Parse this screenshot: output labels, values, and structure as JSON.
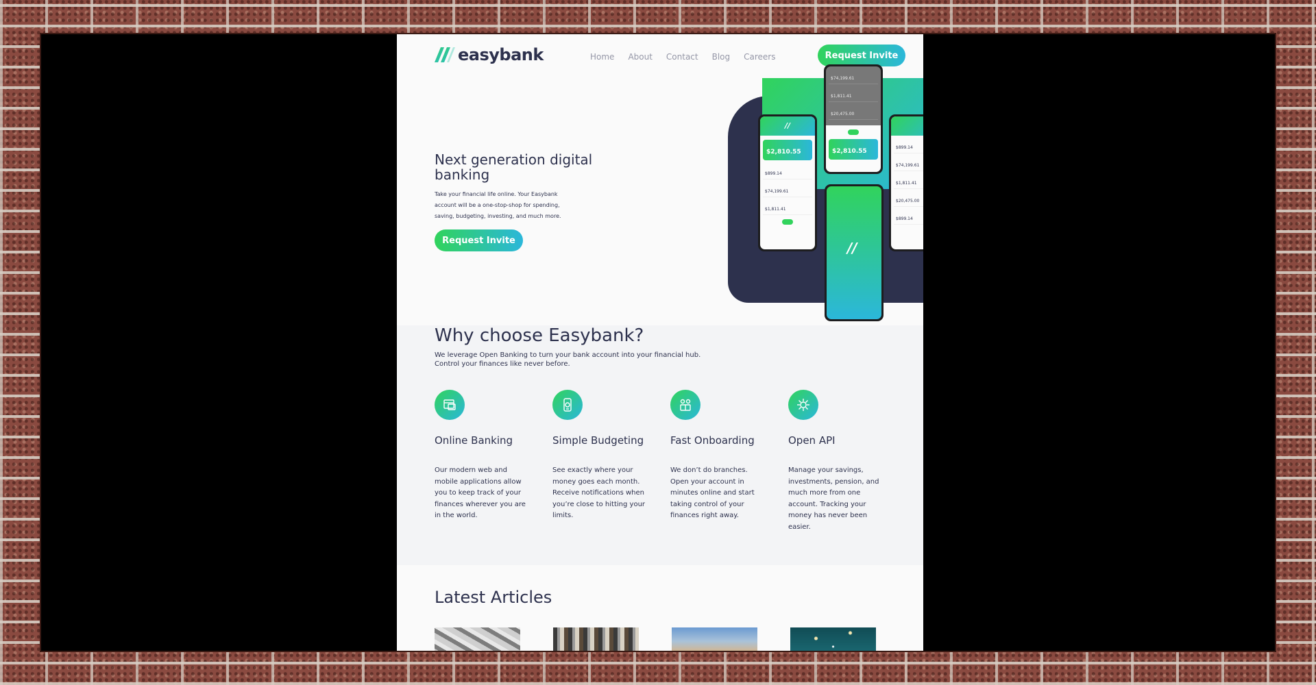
{
  "nav": {
    "logo_text": "easybank",
    "links": [
      "Home",
      "About",
      "Contact",
      "Blog",
      "Careers"
    ],
    "cta_label": "Request Invite"
  },
  "hero": {
    "title": "Next generation digital banking",
    "text": "Take your financial life online. Your Easybank account will be a one-stop-shop for spending, saving, budgeting, investing, and much more.",
    "cta_label": "Request Invite",
    "phone_screens": {
      "left": {
        "card": "$2,810.55",
        "rows": [
          "$899.14",
          "$74,199.61",
          "$1,811.41"
        ]
      },
      "top": {
        "rows": [
          "$74,199.61",
          "$1,811.41",
          "$20,475.00"
        ],
        "card": "$2,810.55"
      },
      "right": {
        "rows": [
          "$899.14",
          "$74,199.61",
          "$1,811.41",
          "$20,475.00",
          "$899.14"
        ]
      }
    }
  },
  "why": {
    "title": "Why choose Easybank?",
    "subtitle": "We leverage Open Banking to turn your bank account into your financial hub. Control your finances like never before.",
    "features": [
      {
        "icon": "online-banking-icon",
        "title": "Online Banking",
        "text": "Our modern web and mobile applications allow you to keep track of your finances wherever you are in the world."
      },
      {
        "icon": "budgeting-icon",
        "title": "Simple Budgeting",
        "text": "See exactly where your money goes each month. Receive notifications when you’re close to hitting your limits."
      },
      {
        "icon": "onboarding-icon",
        "title": "Fast Onboarding",
        "text": "We don’t do branches. Open your account in minutes online and start taking control of your finances right away."
      },
      {
        "icon": "api-icon",
        "title": "Open API",
        "text": "Manage your savings, investments, pension, and much more from one account. Tracking your money has never been easier."
      }
    ]
  },
  "articles": {
    "title": "Latest Articles"
  },
  "colors": {
    "lime_green": "#31d35c",
    "bright_cyan": "#2bb7da",
    "dark_blue": "#2d314d",
    "grayish_blue": "#9597a7",
    "light_gray": "#f3f4f6"
  }
}
